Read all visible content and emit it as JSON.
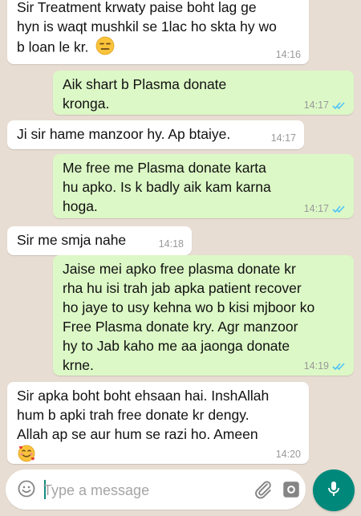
{
  "messages": [
    {
      "dir": "in",
      "text": "Sir Treatment krwaty paise boht lag ge\nhyn is waqt mushkil se 1lac ho skta hy wo\nb loan le kr.",
      "emoji": "expressionless-face",
      "time": "14:16"
    },
    {
      "dir": "out",
      "text": "Aik shart b Plasma donate\nkronga.",
      "time": "14:17",
      "status": "read"
    },
    {
      "dir": "in",
      "text": "Ji sir hame manzoor hy. Ap btaiye.",
      "time": "14:17"
    },
    {
      "dir": "out",
      "text": "Me free me Plasma donate karta\nhu apko. Is k badly aik kam karna\nhoga.",
      "time": "14:17",
      "status": "read"
    },
    {
      "dir": "in",
      "text": "Sir me smja nahe",
      "time": "14:18"
    },
    {
      "dir": "out",
      "text": "Jaise mei apko free plasma donate kr\nrha hu isi trah jab apka patient recover\nho jaye to usy kehna wo b kisi mjboor ko\nFree Plasma donate kry. Agr manzoor\nhy to Jab kaho me aa jaonga donate\nkrne.",
      "time": "14:19",
      "status": "read"
    },
    {
      "dir": "in",
      "text": "Sir apka boht boht ehsaan hai. InshAllah\nhum b apki trah free donate kr dengy.\nAllah ap se aur hum se razi ho. Ameen",
      "emoji": "smiling-face-with-hearts",
      "time": "14:20"
    }
  ],
  "composer": {
    "placeholder": "Type a message",
    "value": ""
  },
  "icons": {
    "emoji_button": "smiley-icon",
    "attach": "paperclip-icon",
    "camera": "camera-icon",
    "mic": "microphone-icon",
    "read_receipt": "double-check-icon"
  },
  "colors": {
    "chat_background": "#e8ddd3",
    "incoming_bubble": "#ffffff",
    "outgoing_bubble": "#dcf8c6",
    "read_tick": "#4fc3f7",
    "mic_button": "#00897b"
  }
}
